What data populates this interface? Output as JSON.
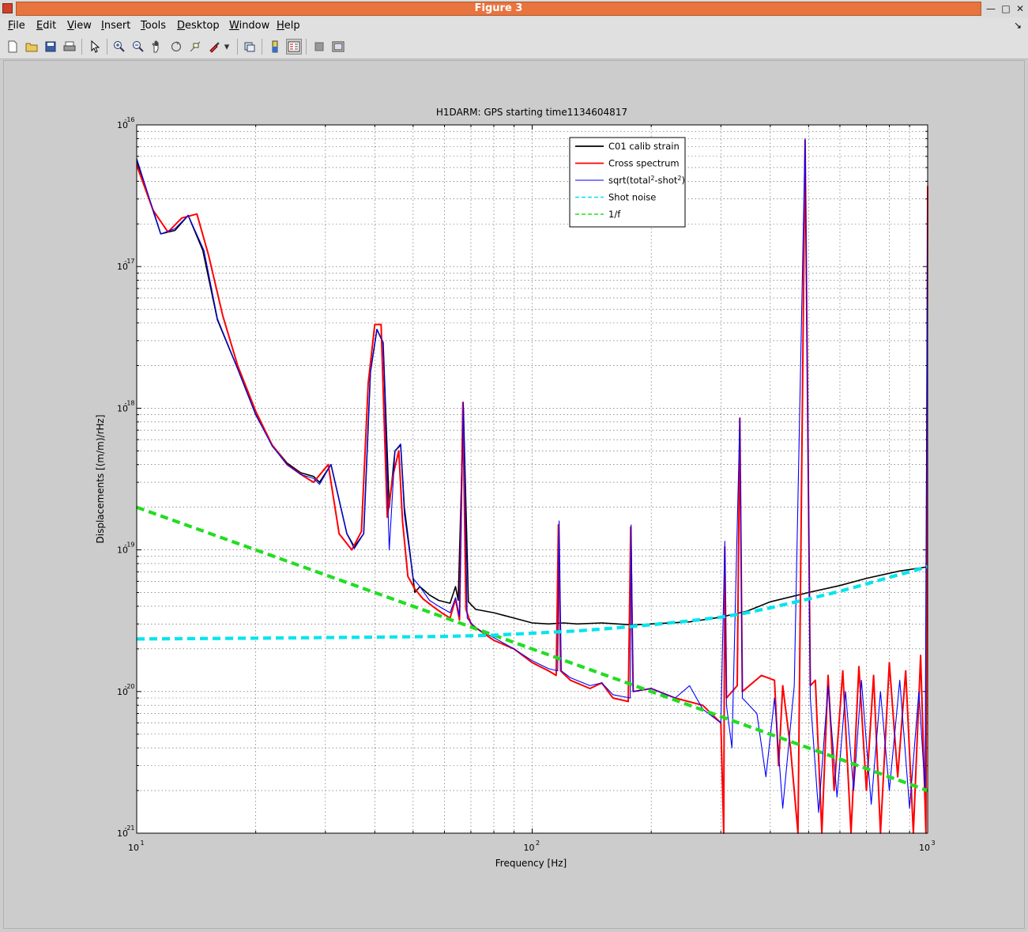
{
  "window": {
    "title": "Figure 3"
  },
  "menu": {
    "items": [
      {
        "key": "F",
        "rest": "ile"
      },
      {
        "key": "E",
        "rest": "dit"
      },
      {
        "key": "V",
        "rest": "iew"
      },
      {
        "key": "I",
        "rest": "nsert"
      },
      {
        "key": "T",
        "rest": "ools"
      },
      {
        "key": "D",
        "rest": "esktop"
      },
      {
        "key": "W",
        "rest": "indow"
      },
      {
        "key": "H",
        "rest": "elp"
      }
    ]
  },
  "toolbar": {
    "icons": [
      "new-figure-icon",
      "open-file-icon",
      "save-icon",
      "print-icon",
      "edit-plot-pointer-icon",
      "zoom-in-icon",
      "zoom-out-icon",
      "pan-hand-icon",
      "rotate-3d-icon",
      "data-cursor-icon",
      "brush-icon",
      "brush-dropdown-icon",
      "link-plot-icon",
      "insert-colorbar-icon",
      "insert-legend-icon",
      "hide-plot-tools-icon",
      "show-plot-tools-icon"
    ]
  },
  "colors": {
    "titlebar_accent": "#e8743f",
    "calib": "#000000",
    "cross": "#ff0000",
    "sqrt": "#0000ff",
    "shot": "#00e5ee",
    "oneoverf": "#22dd22"
  },
  "chart_data": {
    "type": "line",
    "title": "H1DARM: GPS starting time1134604817",
    "xlabel": "Frequency [Hz]",
    "ylabel": "Displacements [(m/m)/rHz]",
    "xscale": "log",
    "yscale": "log",
    "xlim": [
      10,
      1000
    ],
    "ylim": [
      1e-21,
      1e-16
    ],
    "grid": true,
    "legend_position": "top-center",
    "x_ticks": [
      {
        "base": "10",
        "exp": "1"
      },
      {
        "base": "10",
        "exp": "2"
      },
      {
        "base": "10",
        "exp": "3"
      }
    ],
    "y_ticks": [
      {
        "base": "10",
        "exp": "-21"
      },
      {
        "base": "10",
        "exp": "-20"
      },
      {
        "base": "10",
        "exp": "-19"
      },
      {
        "base": "10",
        "exp": "-18"
      },
      {
        "base": "10",
        "exp": "-17"
      },
      {
        "base": "10",
        "exp": "-16"
      }
    ],
    "series": [
      {
        "name": "C01 calib strain",
        "style": "solid",
        "points": [
          [
            10,
            5.6e-17
          ],
          [
            11.5,
            1.7e-17
          ],
          [
            12.5,
            1.8e-17
          ],
          [
            13.5,
            2.3e-17
          ],
          [
            14.7,
            1.3e-17
          ],
          [
            16,
            4.2e-18
          ],
          [
            18,
            1.9e-18
          ],
          [
            20,
            9e-19
          ],
          [
            22,
            5.5e-19
          ],
          [
            24,
            4.1e-19
          ],
          [
            26,
            3.5e-19
          ],
          [
            28,
            3.3e-19
          ],
          [
            29,
            3e-19
          ],
          [
            31,
            4e-19
          ],
          [
            34,
            1.3e-19
          ],
          [
            35.5,
            1.05e-19
          ],
          [
            37.5,
            1.3e-19
          ],
          [
            39,
            1.8e-18
          ],
          [
            40.5,
            3.6e-18
          ],
          [
            42,
            2.9e-18
          ],
          [
            43.5,
            2e-19
          ],
          [
            45,
            5e-19
          ],
          [
            46.5,
            5.5e-19
          ],
          [
            47.5,
            2e-19
          ],
          [
            50.5,
            5e-20
          ],
          [
            52,
            5.5e-20
          ],
          [
            55,
            4.8e-20
          ],
          [
            58,
            4.4e-20
          ],
          [
            62,
            4.2e-20
          ],
          [
            64,
            5.5e-20
          ],
          [
            65,
            4.4e-20
          ],
          [
            67,
            9.8e-19
          ],
          [
            69,
            4.3e-20
          ],
          [
            72,
            3.8e-20
          ],
          [
            80,
            3.6e-20
          ],
          [
            90,
            3.3e-20
          ],
          [
            100,
            3.05e-20
          ],
          [
            110,
            3e-20
          ],
          [
            120,
            3.05e-20
          ],
          [
            130,
            3e-20
          ],
          [
            150,
            3.05e-20
          ],
          [
            180,
            2.95e-20
          ],
          [
            200,
            3e-20
          ],
          [
            250,
            3.1e-20
          ],
          [
            300,
            3.35e-20
          ],
          [
            350,
            3.7e-20
          ],
          [
            400,
            4.3e-20
          ],
          [
            500,
            5e-20
          ],
          [
            600,
            5.6e-20
          ],
          [
            700,
            6.3e-20
          ],
          [
            850,
            7.1e-20
          ],
          [
            1000,
            7.6e-20
          ]
        ]
      },
      {
        "name": "Cross spectrum",
        "style": "solid",
        "points": [
          [
            10,
            5.2e-17
          ],
          [
            11,
            2.5e-17
          ],
          [
            12,
            1.75e-17
          ],
          [
            13,
            2.2e-17
          ],
          [
            14.2,
            2.35e-17
          ],
          [
            15.2,
            1.2e-17
          ],
          [
            16.5,
            4.5e-18
          ],
          [
            18,
            2e-18
          ],
          [
            20,
            9.5e-19
          ],
          [
            22,
            5.5e-19
          ],
          [
            24,
            4e-19
          ],
          [
            26.5,
            3.3e-19
          ],
          [
            28,
            3e-19
          ],
          [
            30.5,
            4e-19
          ],
          [
            32.5,
            1.3e-19
          ],
          [
            35,
            1e-19
          ],
          [
            37,
            1.35e-19
          ],
          [
            38.5,
            1.5e-18
          ],
          [
            40,
            3.9e-18
          ],
          [
            41.5,
            3.9e-18
          ],
          [
            43,
            1.7e-19
          ],
          [
            44.5,
            3.4e-19
          ],
          [
            46,
            5e-19
          ],
          [
            47,
            1.6e-19
          ],
          [
            48.5,
            6.5e-20
          ],
          [
            50.5,
            5.3e-20
          ],
          [
            53,
            4.5e-20
          ],
          [
            56,
            4e-20
          ],
          [
            59,
            3.6e-20
          ],
          [
            62,
            3.3e-20
          ],
          [
            64,
            4.5e-20
          ],
          [
            65.5,
            3.2e-20
          ],
          [
            66.8,
            1.1e-18
          ],
          [
            68,
            3.8e-20
          ],
          [
            70,
            3e-20
          ],
          [
            75,
            2.6e-20
          ],
          [
            80,
            2.3e-20
          ],
          [
            90,
            2e-20
          ],
          [
            100,
            1.6e-20
          ],
          [
            110,
            1.4e-20
          ],
          [
            115,
            1.3e-20
          ],
          [
            116.5,
            1.5e-19
          ],
          [
            118,
            1.4e-20
          ],
          [
            125,
            1.2e-20
          ],
          [
            140,
            1.05e-20
          ],
          [
            150,
            1.15e-20
          ],
          [
            160,
            9e-21
          ],
          [
            175,
            8.5e-21
          ],
          [
            177.5,
            1.45e-19
          ],
          [
            180,
            1e-20
          ],
          [
            200,
            1.05e-20
          ],
          [
            230,
            9e-21
          ],
          [
            270,
            8e-21
          ],
          [
            300,
            6e-21
          ],
          [
            305,
            1e-21
          ],
          [
            307,
            1.05e-19
          ],
          [
            310,
            9e-21
          ],
          [
            330,
            1.1e-20
          ],
          [
            335,
            8.5e-19
          ],
          [
            340,
            1e-20
          ],
          [
            380,
            1.3e-20
          ],
          [
            410,
            1.2e-20
          ],
          [
            420,
            3e-21
          ],
          [
            430,
            1.1e-20
          ],
          [
            450,
            4e-21
          ],
          [
            470,
            1e-21
          ],
          [
            490,
            7.8e-17
          ],
          [
            505,
            1.1e-20
          ],
          [
            520,
            1.2e-20
          ],
          [
            540,
            1e-21
          ],
          [
            560,
            1.3e-20
          ],
          [
            580,
            2e-21
          ],
          [
            610,
            1.4e-20
          ],
          [
            640,
            1e-21
          ],
          [
            670,
            1.5e-20
          ],
          [
            700,
            2e-21
          ],
          [
            730,
            1.3e-20
          ],
          [
            760,
            1e-21
          ],
          [
            800,
            1.6e-20
          ],
          [
            840,
            2.5e-21
          ],
          [
            880,
            1.4e-20
          ],
          [
            920,
            1e-21
          ],
          [
            960,
            1.8e-20
          ],
          [
            990,
            1e-21
          ],
          [
            1000,
            3.7e-17
          ]
        ]
      },
      {
        "name": "sqrt(total^2-shot^2)",
        "style": "solid",
        "points": [
          [
            10,
            5.8e-17
          ],
          [
            11.5,
            1.7e-17
          ],
          [
            12.5,
            1.85e-17
          ],
          [
            13.5,
            2.3e-17
          ],
          [
            14.8,
            1.3e-17
          ],
          [
            16,
            4.3e-18
          ],
          [
            18,
            1.9e-18
          ],
          [
            20,
            9e-19
          ],
          [
            22,
            5.4e-19
          ],
          [
            24,
            4e-19
          ],
          [
            26,
            3.4e-19
          ],
          [
            28,
            3.2e-19
          ],
          [
            29,
            2.9e-19
          ],
          [
            31,
            4e-19
          ],
          [
            34,
            1.3e-19
          ],
          [
            35.5,
            1.02e-19
          ],
          [
            37.5,
            1.3e-19
          ],
          [
            39,
            1.8e-18
          ],
          [
            40.5,
            3.6e-18
          ],
          [
            42,
            2.9e-18
          ],
          [
            43.5,
            1e-19
          ],
          [
            45,
            5e-19
          ],
          [
            46.5,
            5.6e-19
          ],
          [
            47.5,
            1.8e-19
          ],
          [
            50,
            6.3e-20
          ],
          [
            52,
            5.5e-20
          ],
          [
            55,
            4.4e-20
          ],
          [
            58,
            4e-20
          ],
          [
            62,
            3.6e-20
          ],
          [
            64,
            4.6e-20
          ],
          [
            65.5,
            3.4e-20
          ],
          [
            67,
            1.1e-18
          ],
          [
            68.5,
            3.3e-20
          ],
          [
            72,
            2.8e-20
          ],
          [
            80,
            2.4e-20
          ],
          [
            90,
            2e-20
          ],
          [
            100,
            1.65e-20
          ],
          [
            110,
            1.45e-20
          ],
          [
            116,
            1.4e-20
          ],
          [
            117,
            1.6e-19
          ],
          [
            118.5,
            1.4e-20
          ],
          [
            125,
            1.25e-20
          ],
          [
            140,
            1.1e-20
          ],
          [
            150,
            1.15e-20
          ],
          [
            160,
            9.5e-21
          ],
          [
            177,
            9e-21
          ],
          [
            178,
            1.5e-19
          ],
          [
            180,
            1e-20
          ],
          [
            200,
            1.05e-20
          ],
          [
            230,
            9e-21
          ],
          [
            250,
            1.1e-20
          ],
          [
            270,
            7.5e-21
          ],
          [
            300,
            6e-21
          ],
          [
            307,
            1.15e-19
          ],
          [
            310,
            8e-21
          ],
          [
            320,
            4e-21
          ],
          [
            335,
            8.5e-19
          ],
          [
            340,
            9e-21
          ],
          [
            370,
            7e-21
          ],
          [
            390,
            2.5e-21
          ],
          [
            410,
            9e-21
          ],
          [
            430,
            1.5e-21
          ],
          [
            460,
            1.1e-20
          ],
          [
            490,
            8e-17
          ],
          [
            505,
            9e-21
          ],
          [
            530,
            1.4e-21
          ],
          [
            560,
            1.1e-20
          ],
          [
            590,
            1.8e-21
          ],
          [
            620,
            1e-20
          ],
          [
            650,
            2e-21
          ],
          [
            680,
            1.2e-20
          ],
          [
            720,
            1.6e-21
          ],
          [
            760,
            1e-20
          ],
          [
            800,
            2e-21
          ],
          [
            850,
            1.2e-20
          ],
          [
            900,
            1.5e-21
          ],
          [
            950,
            1e-20
          ],
          [
            985,
            2e-21
          ],
          [
            1000,
            3.5e-17
          ]
        ]
      },
      {
        "name": "Shot noise",
        "style": "dashed",
        "points": [
          [
            10,
            2.35e-20
          ],
          [
            20,
            2.38e-20
          ],
          [
            40,
            2.42e-20
          ],
          [
            60,
            2.45e-20
          ],
          [
            80,
            2.5e-20
          ],
          [
            100,
            2.58e-20
          ],
          [
            130,
            2.68e-20
          ],
          [
            160,
            2.8e-20
          ],
          [
            200,
            2.96e-20
          ],
          [
            250,
            3.15e-20
          ],
          [
            300,
            3.35e-20
          ],
          [
            350,
            3.6e-20
          ],
          [
            400,
            3.9e-20
          ],
          [
            500,
            4.5e-20
          ],
          [
            600,
            5.1e-20
          ],
          [
            700,
            5.75e-20
          ],
          [
            800,
            6.4e-20
          ],
          [
            900,
            7e-20
          ],
          [
            1000,
            7.6e-20
          ]
        ]
      },
      {
        "name": "1/f",
        "style": "dashed",
        "points": [
          [
            10,
            2e-19
          ],
          [
            1000,
            2e-21
          ]
        ]
      }
    ]
  }
}
